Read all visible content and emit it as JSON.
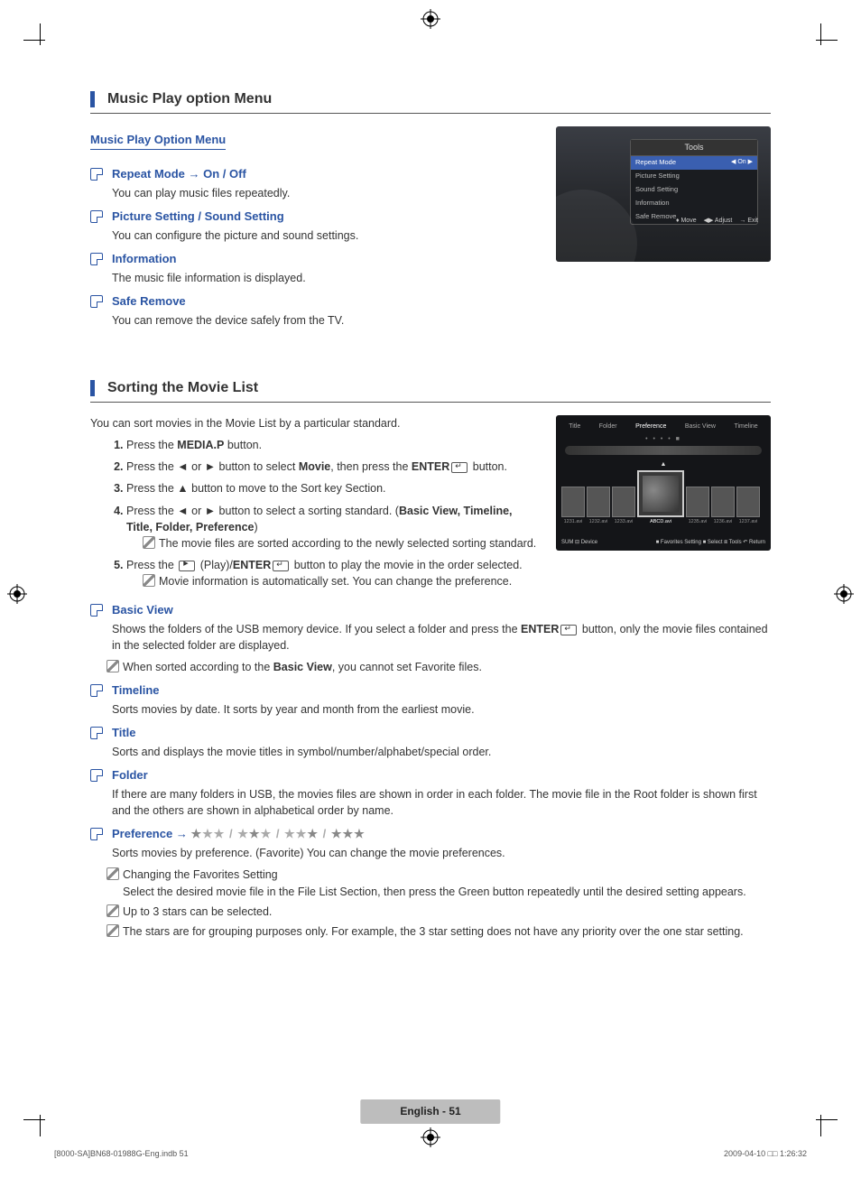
{
  "section1": {
    "heading": "Music Play option Menu",
    "subhead": "Music Play Option Menu",
    "items": [
      {
        "title": "Repeat Mode → On / Off",
        "desc": "You can play music files repeatedly."
      },
      {
        "title": "Picture Setting / Sound Setting",
        "desc": "You can configure the picture and sound settings."
      },
      {
        "title": "Information",
        "desc": "The music file information is displayed."
      },
      {
        "title": "Safe Remove",
        "desc": "You can remove the device safely from the TV."
      }
    ]
  },
  "tools_menu": {
    "title": "Tools",
    "rows": [
      {
        "label": "Repeat Mode",
        "value": "On",
        "selected": true
      },
      {
        "label": "Picture Setting",
        "value": ""
      },
      {
        "label": "Sound Setting",
        "value": ""
      },
      {
        "label": "Information",
        "value": ""
      },
      {
        "label": "Safe Remove",
        "value": ""
      }
    ],
    "foot": [
      "♦ Move",
      "◀▶ Adjust",
      "→ Exit"
    ]
  },
  "section2": {
    "heading": "Sorting the Movie List",
    "intro": "You can sort movies in the Movie List by a particular standard.",
    "steps_text": {
      "s1a": "Press the ",
      "s1b": "MEDIA.P",
      "s1c": " button.",
      "s2a": "Press the ◄ or ► button to select ",
      "s2b": "Movie",
      "s2c": ", then press the ",
      "s2d": "ENTER",
      "s2e": " button.",
      "s3": "Press the ▲ button to move to the Sort key Section.",
      "s4a": "Press the ◄ or ► button to select a sorting standard. (",
      "s4b": "Basic View, Timeline, Title, Folder, Preference",
      "s4c": ")",
      "s4note": "The movie files are sorted according to the newly selected sorting standard.",
      "s5a": "Press the ",
      "s5b": " (Play)/",
      "s5c": "ENTER",
      "s5d": " button to play the movie in the order selected.",
      "s5note": "Movie information is automatically set. You can change the preference."
    },
    "sorts": {
      "basic": {
        "title": "Basic View",
        "desc_a": "Shows the folders of the USB memory device. If you select a folder and press the ",
        "desc_b": "ENTER",
        "desc_c": " button, only the movie files contained in the selected folder are displayed.",
        "note_a": "When sorted according to the ",
        "note_b": "Basic View",
        "note_c": ", you cannot set Favorite files."
      },
      "timeline": {
        "title": "Timeline",
        "desc": "Sorts movies by date. It sorts by year and month from the earliest movie."
      },
      "title": {
        "title": "Title",
        "desc": "Sorts and displays the movie titles in symbol/number/alphabet/special order."
      },
      "folder": {
        "title": "Folder",
        "desc": "If there are many folders in USB, the movies files are shown in order in each folder. The movie file in the Root folder is shown first and the others are shown in alphabetical order by name."
      },
      "pref": {
        "title": "Preference → ",
        "desc": "Sorts movies by preference. (Favorite) You can change the movie preferences.",
        "note1a": "Changing the Favorites Setting",
        "note1b": "Select the desired movie file in the File List Section, then press the Green button repeatedly until the desired setting appears.",
        "note2": "Up to 3 stars can be selected.",
        "note3": "The stars are for grouping purposes only. For example, the 3 star setting does not have any priority over the one star setting."
      }
    }
  },
  "movie_shot": {
    "tabs": [
      "Title",
      "Folder",
      "Preference",
      "Basic View",
      "Timeline"
    ],
    "names": [
      "1231.avi",
      "1232.avi",
      "1233.avi",
      "ABCD.avi",
      "1235.avi",
      "1236.avi",
      "1237.avi"
    ],
    "foot_left": "SUM   ⊟ Device",
    "foot_right": "■ Favorites Setting  ■ Select  ⧈ Tools  ↶ Return"
  },
  "page_foot": "English - 51",
  "doc_foot_left": "[8000-SA]BN68-01988G-Eng.indb   51",
  "doc_foot_right": "2009-04-10   □□ 1:26:32"
}
